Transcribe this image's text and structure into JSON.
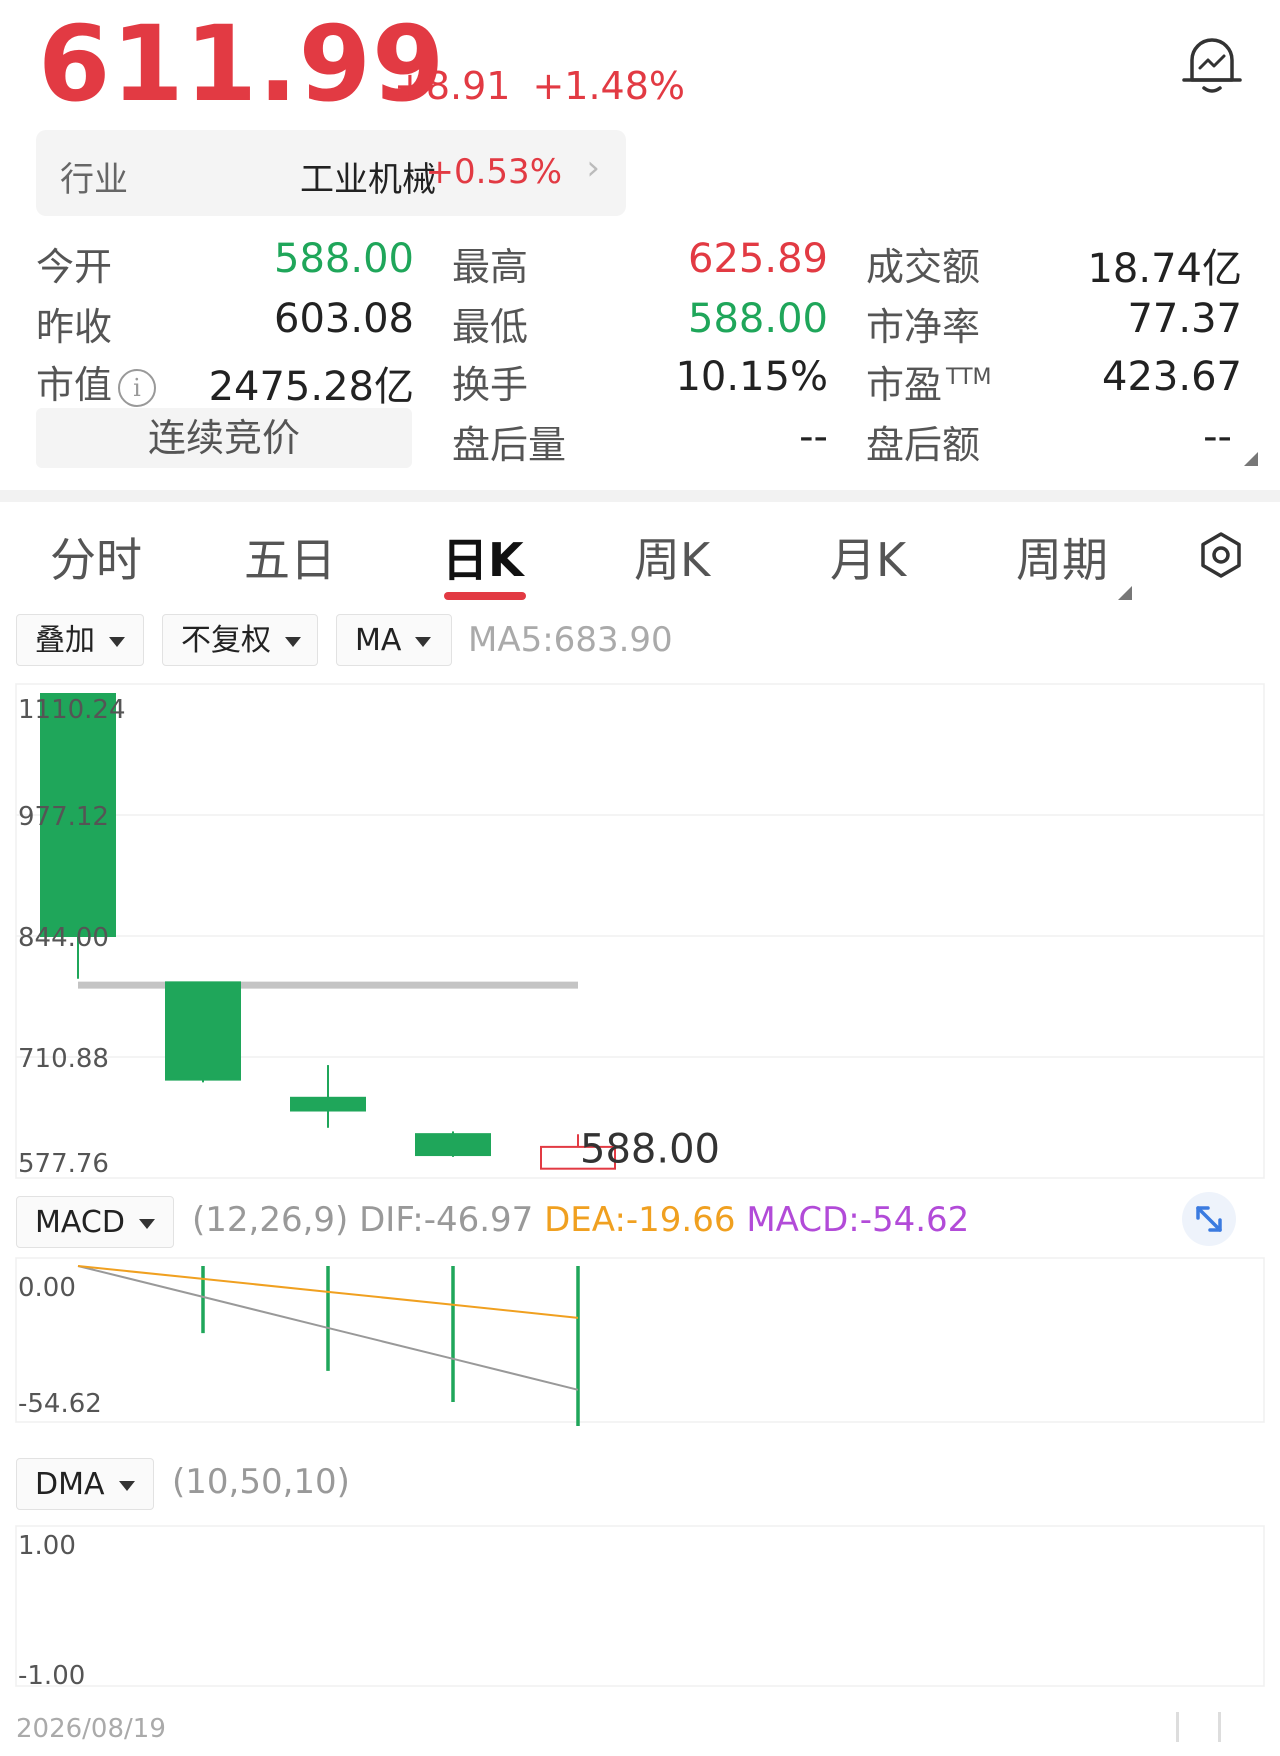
{
  "quote": {
    "price": "611.99",
    "change": "+8.91",
    "change_pct": "+1.48%"
  },
  "industry": {
    "label": "行业",
    "name": "工业机械",
    "change_pct": "+0.53%"
  },
  "stats": {
    "open_label": "今开",
    "open": "588.00",
    "high_label": "最高",
    "high": "625.89",
    "turnover_label": "成交额",
    "turnover": "18.74亿",
    "prev_close_label": "昨收",
    "prev_close": "603.08",
    "low_label": "最低",
    "low": "588.00",
    "pb_label": "市净率",
    "pb": "77.37",
    "mktcap_label": "市值",
    "mktcap": "2475.28亿",
    "turnover_rate_label": "换手",
    "turnover_rate": "10.15%",
    "pe_label": "市盈",
    "pe_sup": "TTM",
    "pe": "423.67",
    "session_label": "连续竞价",
    "ah_vol_label": "盘后量",
    "ah_vol": "--",
    "ah_amt_label": "盘后额",
    "ah_amt": "--"
  },
  "tabs": [
    "分时",
    "五日",
    "日K",
    "周K",
    "月K",
    "周期"
  ],
  "toolbar": {
    "overlay": "叠加",
    "adjust": "不复权",
    "ma": "MA",
    "ma5": "MA5:683.90"
  },
  "colors": {
    "up": "#e23a43",
    "down": "#1fa65a",
    "dea": "#f0a020",
    "macd": "#b24bd8"
  },
  "chart_data": [
    {
      "type": "candlestick",
      "y_ticks": [
        "1110.24",
        "977.12",
        "844.00",
        "710.88",
        "577.76"
      ],
      "ylim": [
        577.76,
        1110.24
      ],
      "candles": [
        {
          "open": 1110.24,
          "close": 844.0,
          "high": 1110.24,
          "low": 797.0
        },
        {
          "open": 793.0,
          "close": 686.0,
          "high": 793.0,
          "low": 683.0
        },
        {
          "open": 666.0,
          "close": 652.0,
          "high": 702.0,
          "low": 633.0
        },
        {
          "open": 626.0,
          "close": 603.0,
          "high": 629.0,
          "low": 601.0
        },
        {
          "open": 588.0,
          "close": 611.99,
          "high": 625.89,
          "low": 588.0
        }
      ],
      "ma5": {
        "value": 790.0,
        "label": "MA5:683.90"
      },
      "last_label": "588.00"
    },
    {
      "type": "line",
      "name": "MACD",
      "params": "(12,26,9)",
      "dif_label": "DIF:-46.97",
      "dea_label": "DEA:-19.66",
      "macd_label": "MACD:-54.62",
      "y_ticks": [
        "0.00",
        "-54.62"
      ],
      "ylim": [
        -54.62,
        0.0
      ],
      "dif": [
        0.0,
        -11.7,
        -23.5,
        -35.2,
        -46.97
      ],
      "dea": [
        0.0,
        -4.9,
        -9.8,
        -14.7,
        -19.66
      ],
      "macd_bars": [
        0,
        -19.4,
        -33.7,
        -45.5,
        -54.62
      ]
    },
    {
      "type": "line",
      "name": "DMA",
      "params": "(10,50,10)",
      "y_ticks": [
        "1.00",
        "-1.00"
      ],
      "ylim": [
        -1.0,
        1.0
      ]
    }
  ],
  "footer": {
    "date": "2026/08/19"
  }
}
